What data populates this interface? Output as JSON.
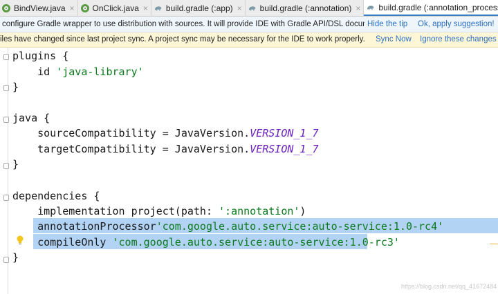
{
  "tabs": [
    {
      "label": "BindView.java",
      "icon": "class-icon",
      "active": false
    },
    {
      "label": "OnClick.java",
      "icon": "annotation-class-icon",
      "active": false
    },
    {
      "label": "build.gradle (:app)",
      "icon": "gradle-icon",
      "active": false
    },
    {
      "label": "build.gradle (:annotation)",
      "icon": "gradle-icon",
      "active": false
    },
    {
      "label": "build.gradle (:annotation_process)",
      "icon": "gradle-icon",
      "active": true
    }
  ],
  "close_glyph": "×",
  "gradle_tip": {
    "message": "configure Gradle wrapper to use distribution with sources. It will provide IDE with Gradle API/DSL documentati",
    "hide_label": "Hide the tip",
    "apply_label": "Ok, apply suggestion!"
  },
  "sync_bar": {
    "message": "iles have changed since last project sync. A project sync may be necessary for the IDE to work properly.",
    "sync_label": "Sync Now",
    "ignore_label": "Ignore these changes"
  },
  "code": {
    "l1": "plugins {",
    "l2_pre": "    id ",
    "l2_str": "'java-library'",
    "l3": "}",
    "l4": "",
    "l5": "java {",
    "l6_pre": "    sourceCompatibility = JavaVersion.",
    "l6_kw": "VERSION_1_7",
    "l7_pre": "    targetCompatibility = JavaVersion.",
    "l7_kw": "VERSION_1_7",
    "l8": "}",
    "l9": "",
    "l10": "dependencies {",
    "l11_pre": "    implementation project(path: ",
    "l11_str": "':annotation'",
    "l11_post": ")",
    "l12_pre": "    annotationProcessor",
    "l12_str": "'com.google.auto.service:auto-service:1.0-rc4'",
    "l13_pre": "    compileOnly ",
    "l13_str": "'com.google.auto.service:auto-service:1.0-rc3'",
    "l14": "}"
  },
  "colors": {
    "string": "#0a7a1c",
    "constant": "#6b1fbf",
    "selection": "#b3d3f5",
    "link": "#2b6fc2"
  },
  "watermark": "https://blog.csdn.net/qq_41672484"
}
